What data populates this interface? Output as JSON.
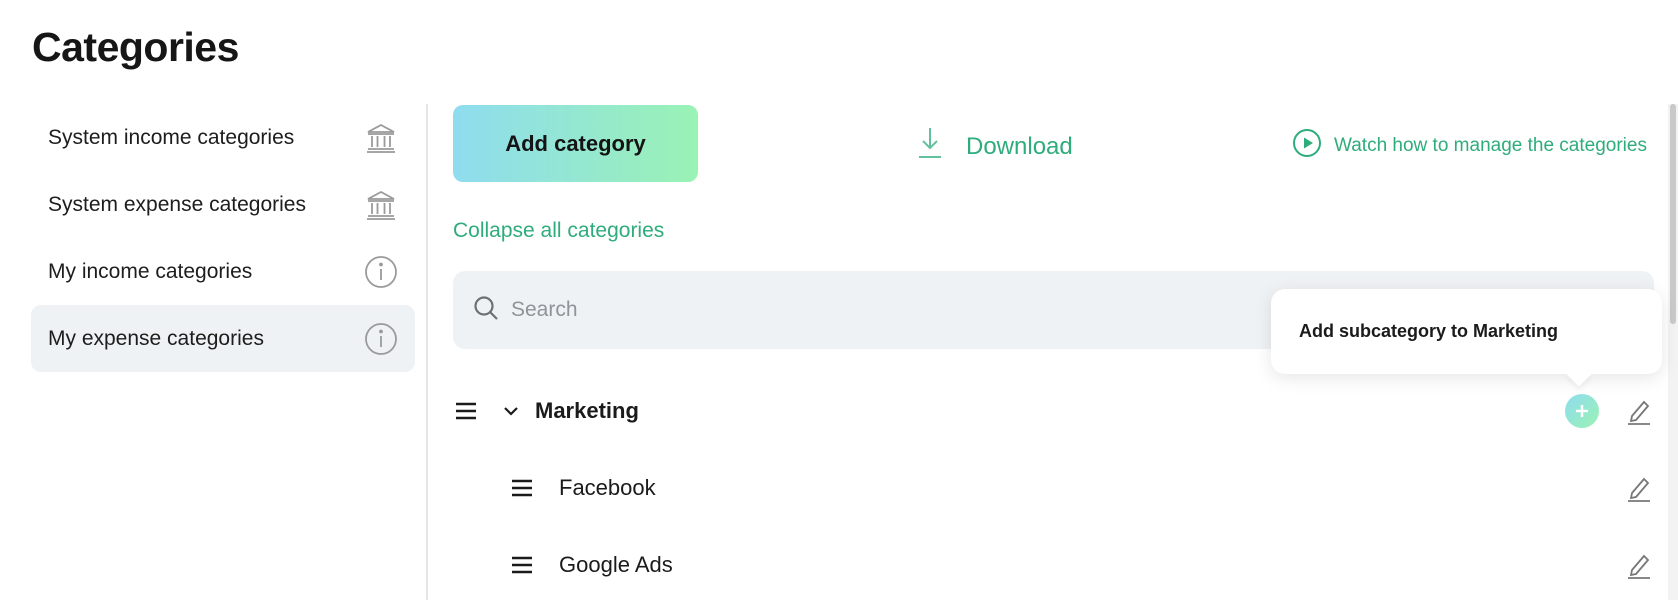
{
  "page": {
    "title": "Categories"
  },
  "sidebar": {
    "items": [
      {
        "label": "System income categories",
        "icon": "bank-icon",
        "active": false
      },
      {
        "label": "System expense categories",
        "icon": "bank-icon",
        "active": false
      },
      {
        "label": "My income categories",
        "icon": "info-icon",
        "active": false
      },
      {
        "label": "My expense categories",
        "icon": "info-icon",
        "active": true
      }
    ]
  },
  "toolbar": {
    "add_label": "Add category",
    "download_label": "Download",
    "watch_label": "Watch how to manage the categories"
  },
  "collapse_label": "Collapse all categories",
  "search": {
    "placeholder": "Search",
    "value": ""
  },
  "popover": {
    "text": "Add subcategory to Marketing"
  },
  "categories": {
    "parent": {
      "name": "Marketing",
      "expanded": true
    },
    "children": [
      "Facebook",
      "Google Ads"
    ]
  },
  "colors": {
    "accent": "#2fac7c",
    "gradient_start": "#8fdcef",
    "gradient_end": "#9af2b4",
    "active_bg": "#eff2f4"
  }
}
